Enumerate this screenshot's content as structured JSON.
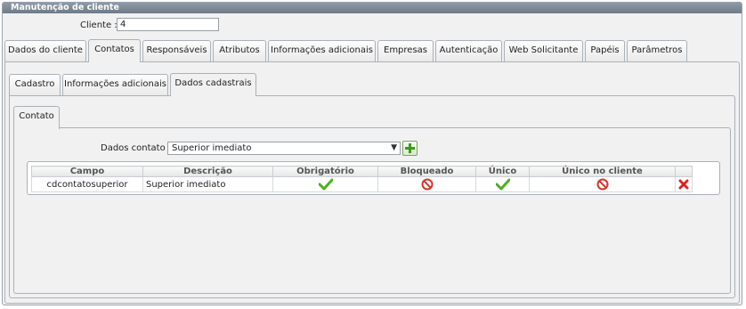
{
  "window": {
    "title": "Manutenção de cliente"
  },
  "client": {
    "label": "Cliente :",
    "value": "4"
  },
  "main_tabs": [
    "Dados do cliente",
    "Contatos",
    "Responsáveis",
    "Atributos",
    "Informações adicionais",
    "Empresas",
    "Autenticação",
    "Web Solicitante",
    "Papéis",
    "Parâmetros"
  ],
  "sub_tabs": [
    "Cadastro",
    "Informações adicionais",
    "Dados cadastrais"
  ],
  "inner_tab": "Contato",
  "dados_contato": {
    "label": "Dados contato :",
    "selected": "Superior imediato"
  },
  "grid": {
    "headers": [
      "Campo",
      "Descrição",
      "Obrigatório",
      "Bloqueado",
      "Único",
      "Único no cliente"
    ],
    "rows": [
      {
        "campo": "cdcontatosuperior",
        "descricao": "Superior imediato",
        "obrigatorio": "check-icon",
        "bloqueado": "blocked-icon",
        "unico": "check-icon",
        "unico_cliente": "blocked-icon"
      }
    ]
  },
  "colors": {
    "titlebar": "#7b8693",
    "check": "#4caf1f",
    "blocked": "#d9322b",
    "delete": "#e02020"
  }
}
